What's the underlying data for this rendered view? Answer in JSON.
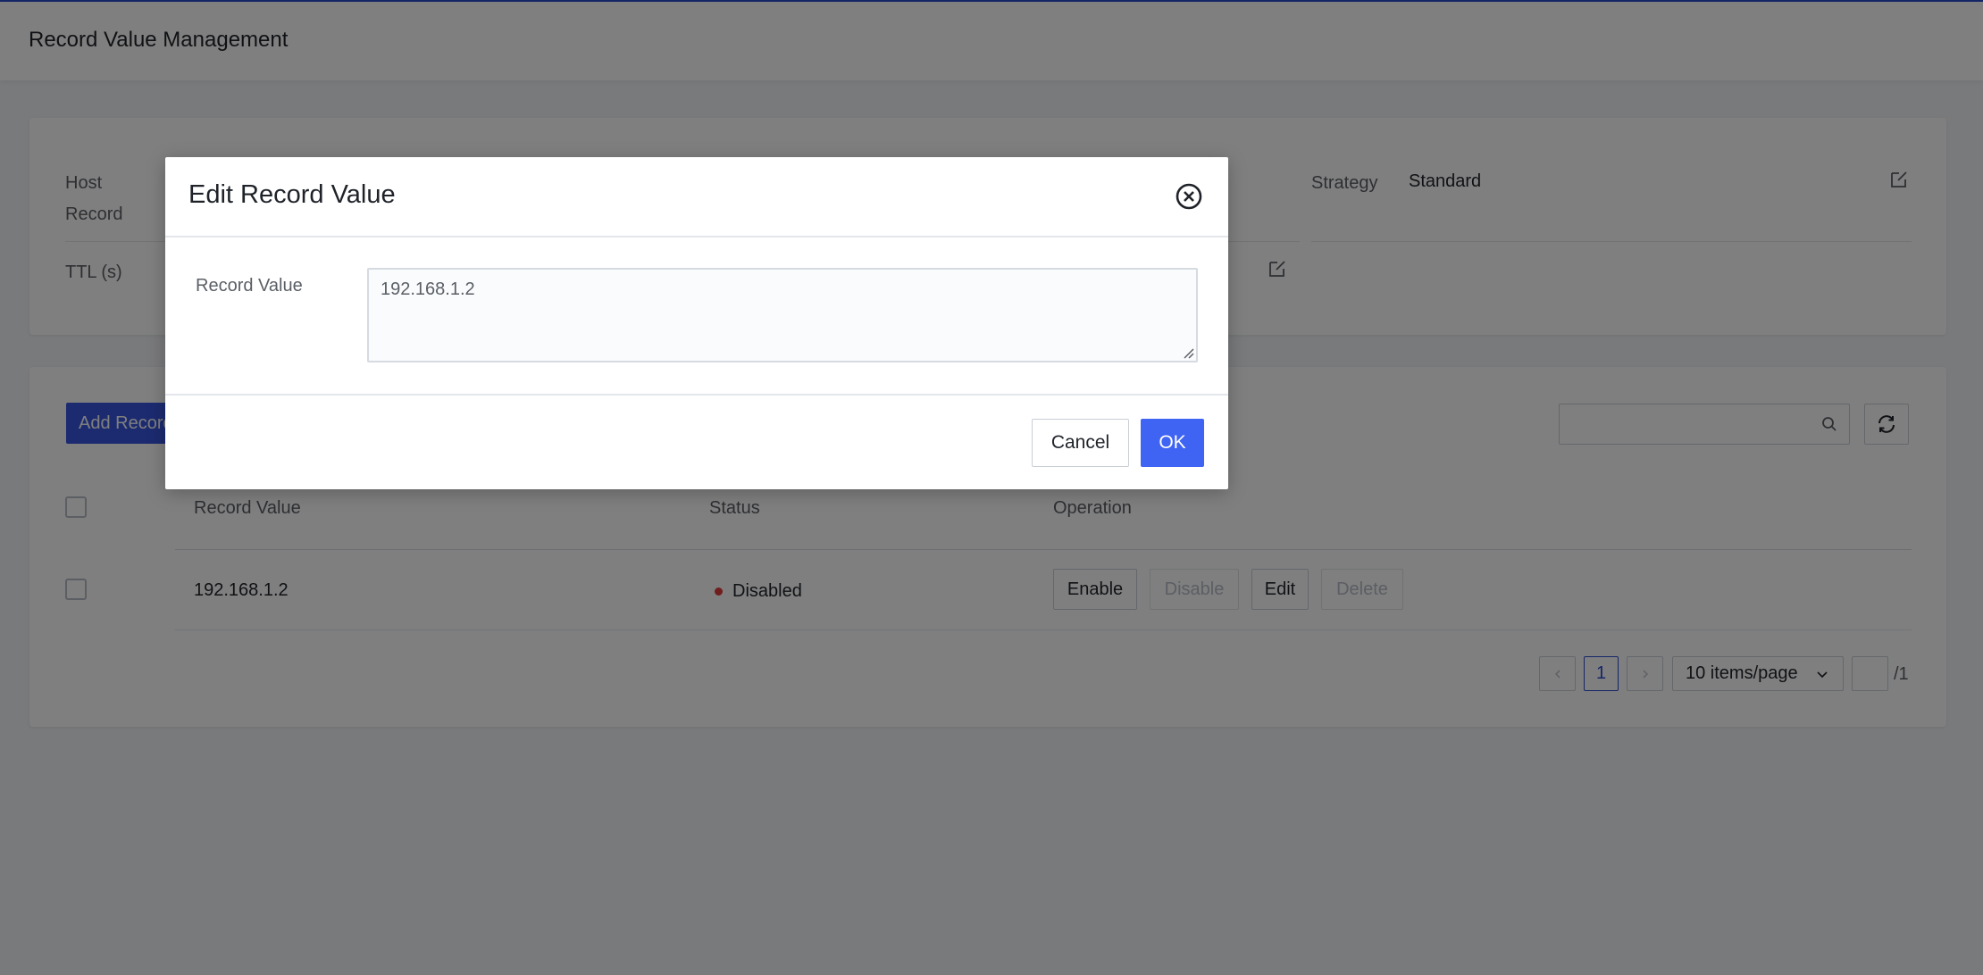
{
  "header": {
    "title": "Record Value Management"
  },
  "info": {
    "host_label": "Host",
    "host_label_2": "Record",
    "ttl_label": "TTL (s)",
    "strategy_label": "Strategy",
    "strategy_value": "Standard"
  },
  "toolbar": {
    "add_label": "Add Record"
  },
  "table": {
    "columns": [
      "Record Value",
      "Status",
      "Operation"
    ],
    "rows": [
      {
        "record_value": "192.168.1.2",
        "status": "Disabled",
        "operations": [
          "Enable",
          "Disable",
          "Edit",
          "Delete"
        ]
      }
    ]
  },
  "pagination": {
    "current_page": "1",
    "page_size": "10 items/page",
    "total_pages": "/1"
  },
  "modal": {
    "title": "Edit Record Value",
    "field_label": "Record Value",
    "field_value": "192.168.1.2",
    "cancel_label": "Cancel",
    "ok_label": "OK"
  },
  "colors": {
    "accent": "#3f63f2",
    "status_disabled": "#e03a3a",
    "top_line": "#2a4bcf"
  }
}
